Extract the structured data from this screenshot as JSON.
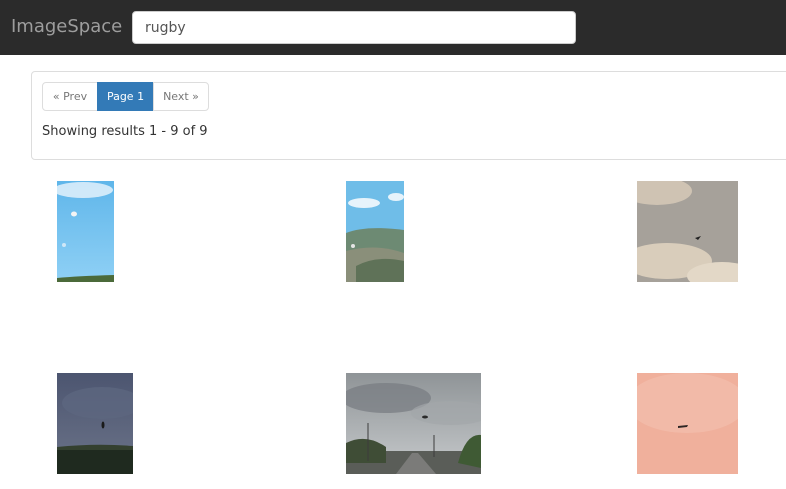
{
  "navbar": {
    "brand": "ImageSpace",
    "search_value": "rugby"
  },
  "pagination": {
    "prev_label": "« Prev",
    "current_label": "Page 1",
    "next_label": "Next »"
  },
  "results_text": "Showing results 1 - 9 of 9",
  "colors": {
    "navbar_bg": "#2b2b2b",
    "brand": "#9d9d9d",
    "active_page": "#337ab7"
  }
}
